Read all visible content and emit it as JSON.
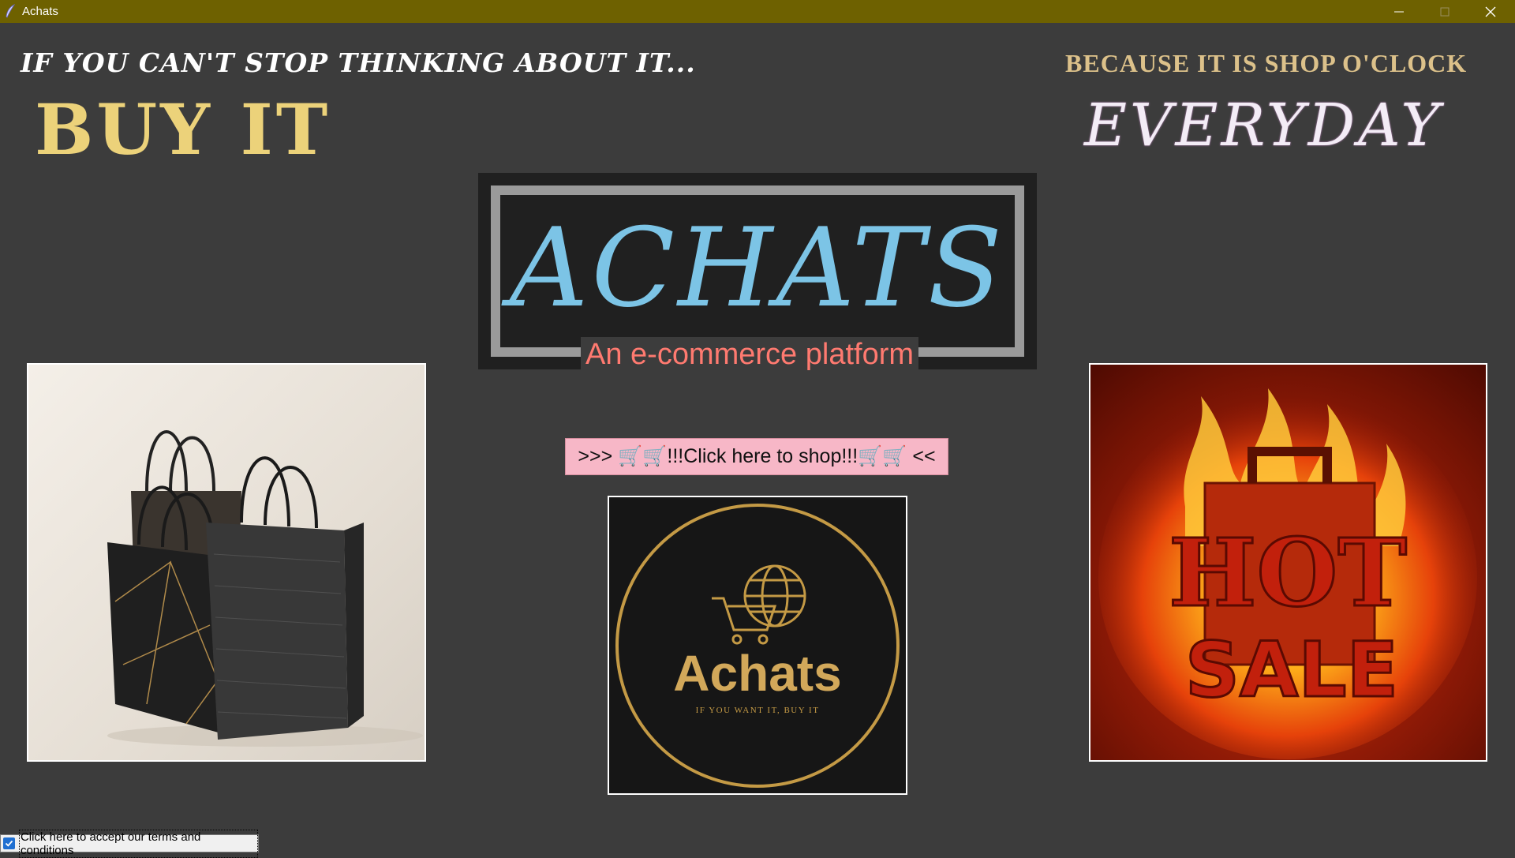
{
  "window": {
    "title": "Achats",
    "title_bar_color": "#6e6100",
    "controls": [
      "minimize-icon",
      "maximize-icon",
      "close-icon"
    ]
  },
  "hero": {
    "tagline_left": "IF YOU CAN'T STOP THINKING ABOUT IT...",
    "headline_left": "BUY IT",
    "tagline_right": "BECAUSE IT IS SHOP O'CLOCK",
    "headline_right": "EVERYDAY"
  },
  "brand": {
    "name": "ACHATS",
    "subtitle": "An e-commerce platform",
    "name_color": "#7cc4e6",
    "subtitle_color": "#ff7a70"
  },
  "shop_button": {
    "label": ">>> 🛒🛒!!!Click here to shop!!!🛒🛒 <<",
    "color": "#f7b7c7"
  },
  "images": {
    "logo_text": "Achats",
    "logo_slogan": "IF YOU WANT IT, BUY IT",
    "sale_line1": "HOT",
    "sale_line2": "SALE"
  },
  "terms": {
    "label": "Click here to accept our terms and conditions",
    "checked": true
  }
}
